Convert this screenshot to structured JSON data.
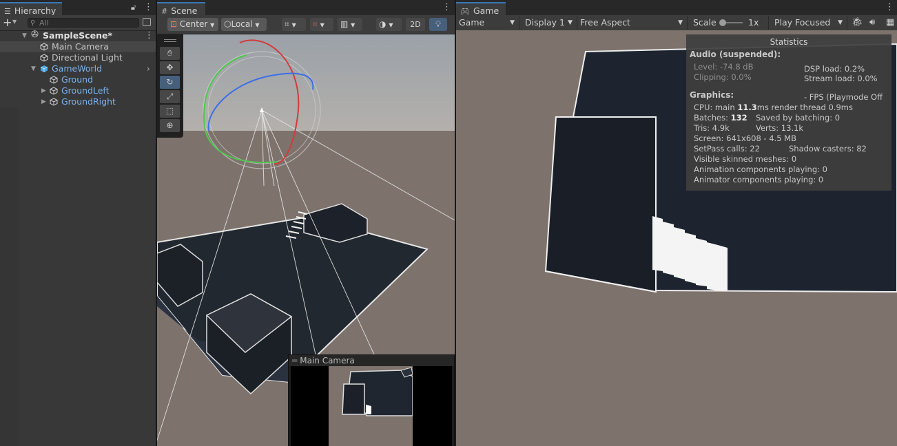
{
  "hierarchy": {
    "tab_label": "Hierarchy",
    "search_placeholder": "All",
    "scene_name": "SampleScene*",
    "items": [
      {
        "label": "Main Camera"
      },
      {
        "label": "Directional Light"
      },
      {
        "label": "GameWorld"
      },
      {
        "label": "Ground"
      },
      {
        "label": "GroundLeft"
      },
      {
        "label": "GroundRight"
      }
    ]
  },
  "scene": {
    "tab_label": "Scene",
    "pivot_label": "Center",
    "space_label": "Local",
    "mode_2d_label": "2D",
    "camera_preview_title": "Main Camera"
  },
  "game": {
    "tab_label": "Game",
    "view_dropdown": "Game",
    "display_dropdown": "Display 1",
    "aspect_dropdown": "Free Aspect",
    "scale_label": "Scale",
    "scale_value": "1x",
    "scale_fraction": 0.0,
    "play_mode_dropdown": "Play Focused",
    "stats": {
      "title": "Statistics",
      "audio_header": "Audio (suspended):",
      "level": "Level: -74.8 dB",
      "clipping": "Clipping: 0.0%",
      "dsp_load": "DSP load: 0.2%",
      "stream_load": "Stream load: 0.0%",
      "graphics_header": "Graphics:",
      "fps": "- FPS (Playmode Off",
      "cpu_prefix": "CPU: main ",
      "cpu_main": "11.3",
      "cpu_suffix": "ms  render thread 0.9ms",
      "batches_prefix": "Batches: ",
      "batches": "132",
      "saved_by_batching": "Saved by batching: 0",
      "tris": "Tris: 4.9k",
      "verts": "Verts: 13.1k",
      "screen": "Screen: 641x608 - 4.5 MB",
      "setpass": "SetPass calls: 22",
      "shadow_casters": "Shadow casters: 82",
      "skinned_meshes": "Visible skinned meshes: 0",
      "animation_components": "Animation components playing: 0",
      "animator_components": "Animator components playing: 0"
    }
  },
  "colors": {
    "accent": "#3a79bb",
    "prefab_blue": "#7bb2ec",
    "background": "#7d736c"
  }
}
